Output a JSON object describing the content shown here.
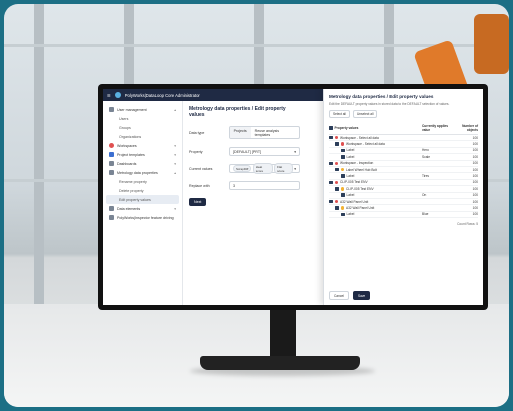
{
  "app": {
    "title": "PolyWorks|DataLoop Core Administrator",
    "help": "Help",
    "user": "Administrator"
  },
  "sidebar": {
    "items": [
      {
        "label": "User management",
        "icon": "users-icon",
        "sub": false
      },
      {
        "label": "Users",
        "sub": true
      },
      {
        "label": "Groups",
        "sub": true
      },
      {
        "label": "Organizations",
        "sub": true
      },
      {
        "label": "Workspaces",
        "icon": "workspace-icon",
        "sub": false
      },
      {
        "label": "Project templates",
        "icon": "template-icon",
        "sub": false
      },
      {
        "label": "Dashboards",
        "icon": "dashboard-icon",
        "sub": false
      },
      {
        "label": "Metrology data properties",
        "icon": "metrology-icon",
        "sub": false
      },
      {
        "label": "Rename property",
        "sub": true
      },
      {
        "label": "Delete property",
        "sub": true
      },
      {
        "label": "Edit property values",
        "sub": true,
        "active": true
      },
      {
        "label": "Data elements",
        "icon": "data-icon",
        "sub": false
      },
      {
        "label": "PolyWorks|Inspector feature driving",
        "icon": "feature-icon",
        "sub": false
      }
    ]
  },
  "main": {
    "title": "Metrology data properties / Edit property values",
    "data_type_label": "Data type",
    "seg_a": "Projects",
    "seg_b": "Reuse analysis templates",
    "property_label": "Property",
    "property_value": "[DEFAULT] [PRT]",
    "current_values_label": "Current values",
    "chips": [
      "ScrapDiff",
      "Heat score",
      "Flat score"
    ],
    "replace_label": "Replace with",
    "replace_value": "3",
    "next_button": "Next"
  },
  "panel": {
    "title": "Metrology data properties / Edit property values",
    "desc": "Edit the DEFAULT property values in stored data to the DEFAULT selection of values.",
    "btn_select_all": "Select all",
    "btn_unselect": "Unselect all",
    "col_name": "Property values",
    "col_status": "Currently applies value",
    "col_count": "Number of objects",
    "rows": [
      {
        "label": "Workspace - Select all data",
        "status": "",
        "count": "100",
        "lvl": 0,
        "kind": "red"
      },
      {
        "label": "Workspace - Select all data",
        "status": "",
        "count": "100",
        "lvl": 1,
        "kind": "red"
      },
      {
        "label": "Label",
        "status": "Hero",
        "count": "100",
        "lvl": 2,
        "kind": ""
      },
      {
        "label": "Label",
        "status": "Scale",
        "count": "100",
        "lvl": 2,
        "kind": ""
      },
      {
        "label": "Workspace - Inspection",
        "status": "",
        "count": "100",
        "lvl": 0,
        "kind": "red"
      },
      {
        "label": "Label Wheel Hub Bolt",
        "status": "",
        "count": "100",
        "lvl": 1,
        "kind": "yel"
      },
      {
        "label": "Label",
        "status": "Tires",
        "count": "100",
        "lvl": 2,
        "kind": ""
      },
      {
        "label": "CLIP-005 Test ENV",
        "status": "",
        "count": "100",
        "lvl": 0,
        "kind": "red"
      },
      {
        "label": "CLIP-005 Test ENV",
        "status": "",
        "count": "100",
        "lvl": 1,
        "kind": "yel"
      },
      {
        "label": "Label",
        "status": "On",
        "count": "100",
        "lvl": 2,
        "kind": ""
      },
      {
        "label": "A32 Wall Panel Unit",
        "status": "",
        "count": "100",
        "lvl": 0,
        "kind": "red"
      },
      {
        "label": "A32 Wall Panel Unit",
        "status": "",
        "count": "100",
        "lvl": 1,
        "kind": "yel"
      },
      {
        "label": "Label",
        "status": "Blue",
        "count": "100",
        "lvl": 2,
        "kind": ""
      }
    ],
    "pager": "Count Rows: 5",
    "btn_cancel": "Cancel",
    "btn_save": "Save"
  }
}
